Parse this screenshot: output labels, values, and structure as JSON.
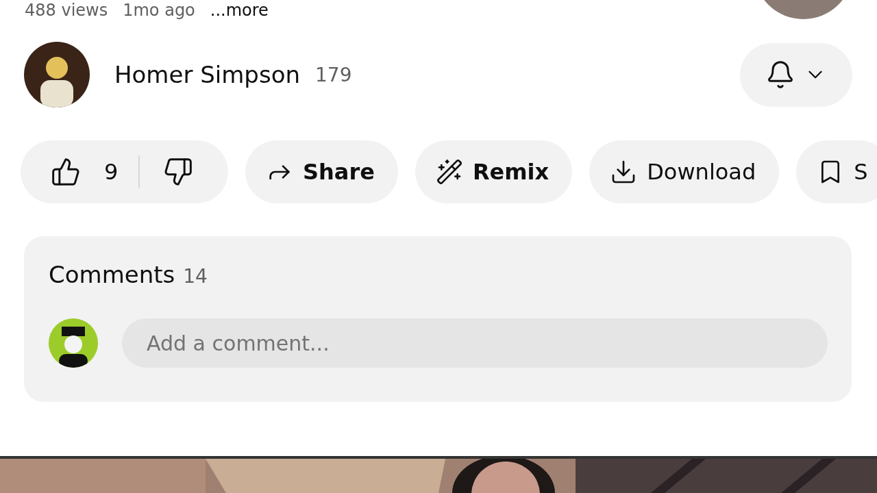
{
  "meta": {
    "views": "488 views",
    "age": "1mo ago",
    "more": "...more"
  },
  "channel": {
    "name": "Homer Simpson",
    "subscribers": "179"
  },
  "actions": [
    {
      "kind": "like",
      "count": "9"
    },
    {
      "kind": "share",
      "label": "Share",
      "bold": true
    },
    {
      "kind": "remix",
      "label": "Remix",
      "bold": true
    },
    {
      "kind": "download",
      "label": "Download",
      "bold": false
    },
    {
      "kind": "save",
      "label": "S",
      "bold": false
    }
  ],
  "comments": {
    "title": "Comments",
    "count": "14",
    "placeholder": "Add a comment..."
  }
}
